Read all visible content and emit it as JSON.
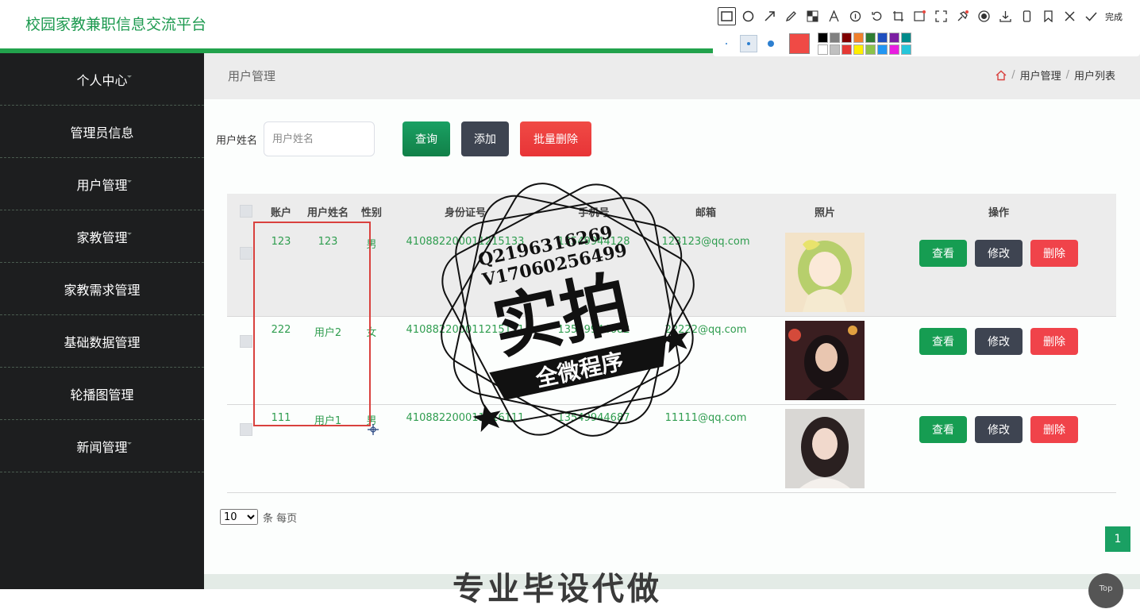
{
  "app": {
    "title": "校园家教兼职信息交流平台"
  },
  "sidebar": {
    "items": [
      {
        "label": "个人中心"
      },
      {
        "label": "管理员信息"
      },
      {
        "label": "用户管理"
      },
      {
        "label": "家教管理"
      },
      {
        "label": "家教需求管理"
      },
      {
        "label": "基础数据管理"
      },
      {
        "label": "轮播图管理"
      },
      {
        "label": "新闻管理"
      }
    ]
  },
  "header": {
    "page_title": "用户管理",
    "breadcrumb": [
      "用户管理",
      "用户列表"
    ],
    "breadcrumb_sep": "/"
  },
  "search": {
    "label": "用户姓名",
    "placeholder": "用户姓名",
    "query_label": "查询",
    "add_label": "添加",
    "bulk_delete_label": "批量删除"
  },
  "table": {
    "columns": [
      "账户",
      "用户姓名",
      "性别",
      "身份证号",
      "手机号",
      "邮箱",
      "照片",
      "操作"
    ],
    "rows": [
      {
        "account": "123",
        "name": "123",
        "gender": "男",
        "id_number": "410882200011215133",
        "phone": "13549944128",
        "email": "123123@qq.com"
      },
      {
        "account": "222",
        "name": "用户2",
        "gender": "女",
        "id_number": "410882200011215111",
        "phone": "13549944682",
        "email": "22222@qq.com"
      },
      {
        "account": "111",
        "name": "用户1",
        "gender": "男",
        "id_number": "410882200011216111",
        "phone": "13549944687",
        "email": "11111@qq.com"
      }
    ],
    "actions": {
      "view": "查看",
      "edit": "修改",
      "delete": "删除"
    }
  },
  "pagination": {
    "page_size": "10",
    "per_page_label": "条 每页",
    "current_page": "1"
  },
  "footer": {
    "text": "专业毕设代做",
    "top_label": "Top"
  },
  "screenshot_toolbar": {
    "done_label": "完成"
  },
  "watermark": {
    "line1": "Q2196316269",
    "line2": "V17060256499",
    "big_text": "实拍",
    "banner": "全微程序"
  },
  "colors": {
    "brand_green": "#1e9a50",
    "accent_red": "#f04a45",
    "dark": "#3e4451",
    "sidebar_bg": "#1d1e1f"
  }
}
